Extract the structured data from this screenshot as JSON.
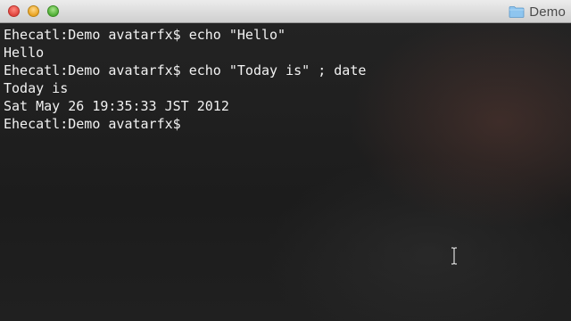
{
  "window": {
    "title": "Demo",
    "title_icon": "folder-icon"
  },
  "terminal": {
    "lines": [
      "Ehecatl:Demo avatarfx$ echo \"Hello\"",
      "Hello",
      "Ehecatl:Demo avatarfx$ echo \"Today is\" ; date",
      "Today is",
      "Sat May 26 19:35:33 JST 2012",
      "Ehecatl:Demo avatarfx$"
    ]
  },
  "colors": {
    "terminal_bg": "#1f1f1f",
    "terminal_fg": "#f2f2f2",
    "titlebar": "#dcdcdc",
    "close": "#e0443e",
    "minimize": "#e9a322",
    "maximize": "#4fae35"
  }
}
